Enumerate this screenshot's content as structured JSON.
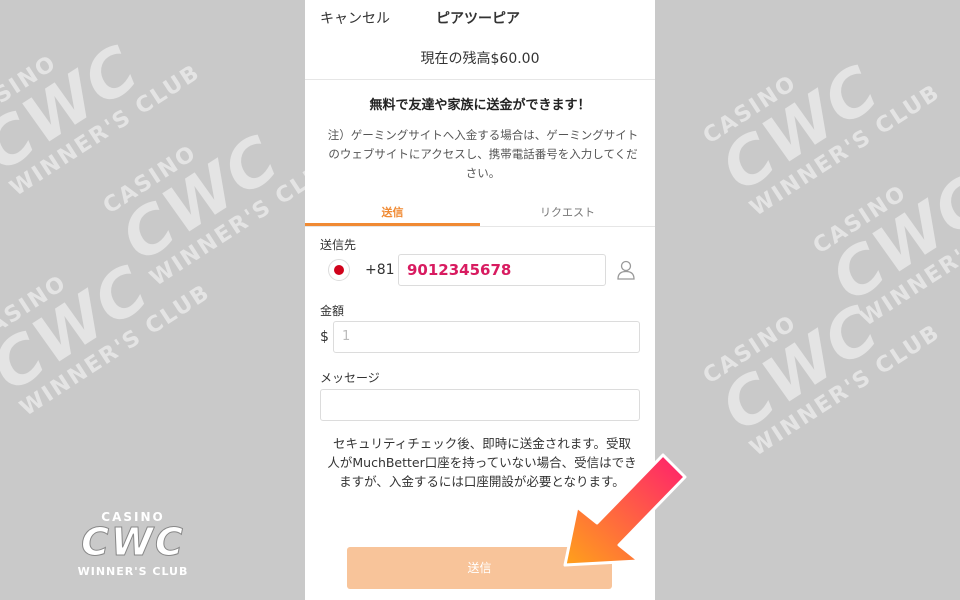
{
  "header": {
    "cancel": "キャンセル",
    "title": "ピアツーピア"
  },
  "balance": "現在の残高$60.00",
  "headline": "無料で友達や家族に送金ができます！",
  "note": "注）ゲーミングサイトへ入金する場合は、ゲーミングサイトのウェブサイトにアクセスし、携帯電話番号を入力してください。",
  "tabs": {
    "send": "送信",
    "request": "リクエスト"
  },
  "recipient": {
    "label": "送信先",
    "country_code": "+81",
    "phone": "9012345678",
    "flag": "japan-flag"
  },
  "amount": {
    "label": "金額",
    "currency": "$",
    "placeholder": "1"
  },
  "message": {
    "label": "メッセージ",
    "value": ""
  },
  "info": "セキュリティチェック後、即時に送金されます。受取人がMuchBetter口座を持っていない場合、受信はできますが、入金するには口座開設が必要となります。",
  "submit": "送信",
  "watermark": {
    "top": "CASINO",
    "main": "CWC",
    "bottom": "WINNER'S CLUB"
  },
  "colors": {
    "accent": "#f08a33",
    "phone_text": "#d81b60",
    "button": "#f8c49a"
  }
}
